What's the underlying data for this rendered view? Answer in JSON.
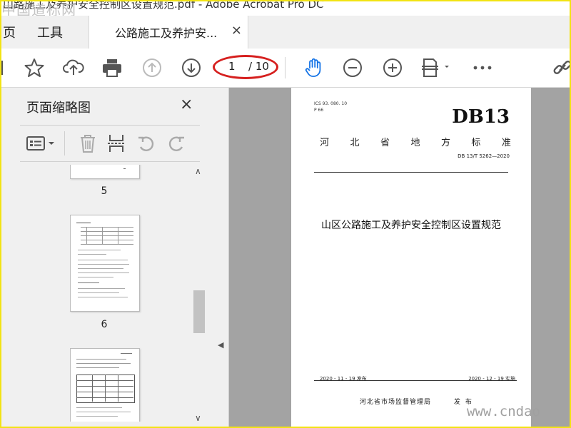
{
  "window": {
    "title": "山路施工及养护安全控制区设置规范.pdf - Adobe Acrobat Pro DC",
    "watermark_top": "中国道标网"
  },
  "tabs": {
    "home": "页",
    "tools": "工具",
    "document": "公路施工及养护安...",
    "close": "×"
  },
  "toolbar": {
    "icons": [
      "star-icon",
      "upload-icon",
      "print-icon",
      "arrow-up-icon",
      "arrow-down-icon",
      "hand-icon",
      "zoom-out-icon",
      "zoom-in-icon",
      "fit-page-icon",
      "more-icon",
      "link-icon"
    ],
    "current_page": "1",
    "total_pages": "/ 10",
    "highlight_color": "#d6201f",
    "hand_color": "#1473e6"
  },
  "sidebar": {
    "title": "页面缩略图",
    "close": "×",
    "thumbnails": [
      {
        "label": "5"
      },
      {
        "label": "6"
      },
      {
        "label": ""
      }
    ]
  },
  "document": {
    "ics": "ICS 93. 080. 10",
    "p": "P 66",
    "code": "DB13",
    "standard_chars": [
      "河",
      "北",
      "省",
      "地",
      "方",
      "标",
      "准"
    ],
    "number": "DB 13/T 5262—2020",
    "title": "山区公路施工及养护安全控制区设置规范",
    "issue_date": "2020 - 11 - 19 发布",
    "impl_date": "2020 - 12 - 19 实施",
    "publisher": "河北省市场监督管理局",
    "publish": "发 布"
  },
  "watermark_bottom": "www.cndao"
}
